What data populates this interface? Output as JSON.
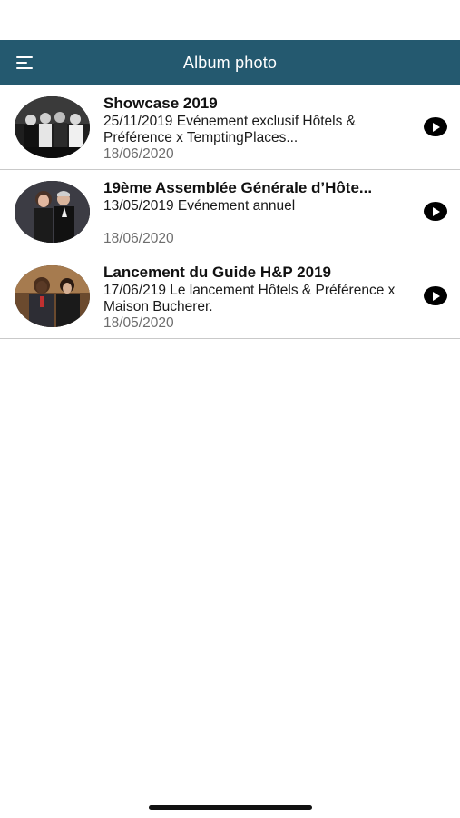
{
  "header": {
    "title": "Album photo",
    "menu_icon": "hamburger-menu-icon",
    "background": "#24596f"
  },
  "albums": [
    {
      "title": "Showcase 2019",
      "description": "25/11/2019 Evénement exclusif Hôtels & Préférence x TemptingPlaces...",
      "date": "18/06/2020",
      "thumbnail": "group-photo-black-white",
      "action_icon": "play-circle-icon"
    },
    {
      "title": "19ème Assemblée Générale d’Hôte...",
      "description": "13/05/2019 Evénement annuel",
      "date": "18/06/2020",
      "thumbnail": "couple-photo-dark",
      "action_icon": "play-circle-icon"
    },
    {
      "title": "Lancement du Guide H&P 2019",
      "description": "17/06/219 Le lancement Hôtels & Préférence x Maison Bucherer.",
      "date": "18/05/2020",
      "thumbnail": "guests-photo-warm",
      "action_icon": "play-circle-icon"
    }
  ]
}
